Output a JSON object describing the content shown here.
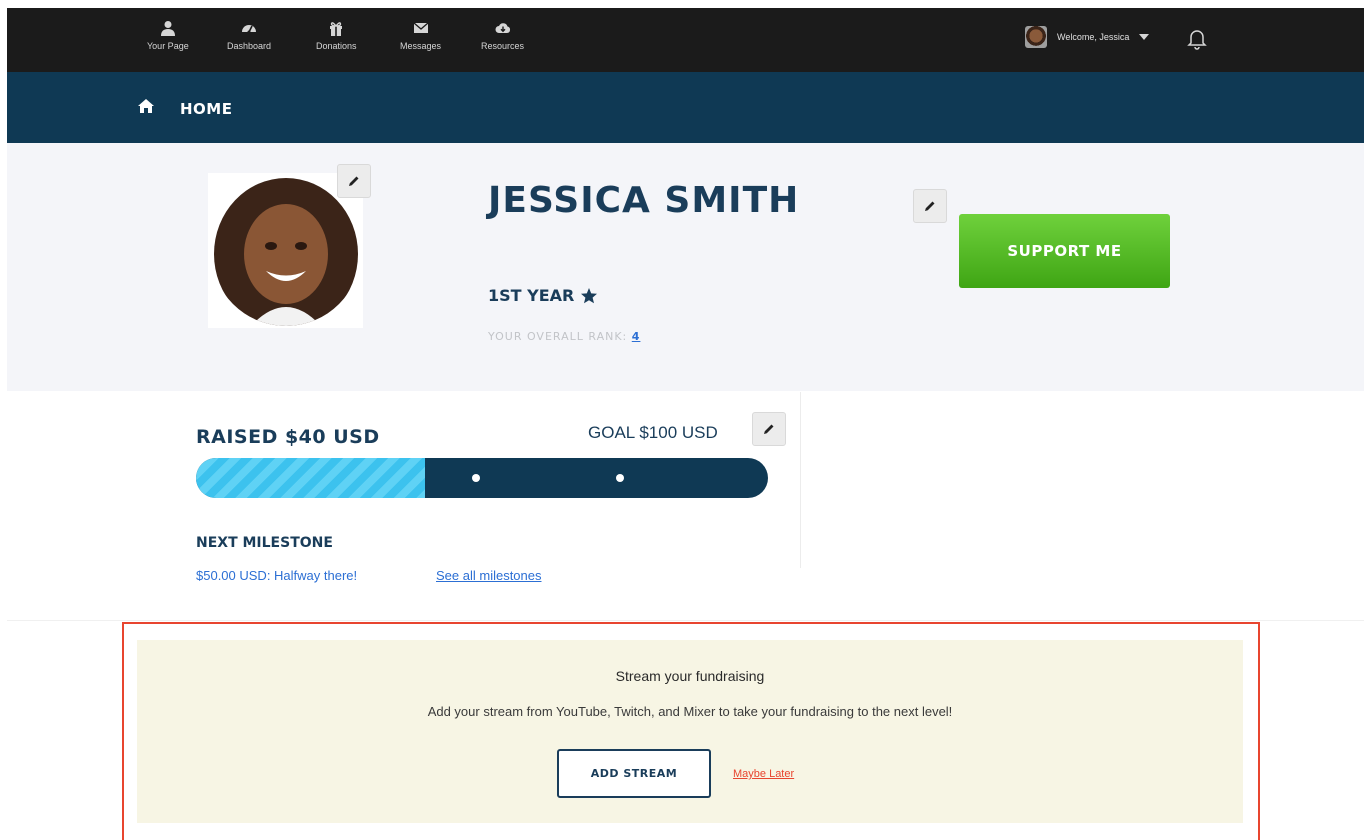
{
  "nav": {
    "items": [
      {
        "label": "Your Page",
        "icon": "user-icon"
      },
      {
        "label": "Dashboard",
        "icon": "dashboard-icon"
      },
      {
        "label": "Donations",
        "icon": "gift-icon"
      },
      {
        "label": "Messages",
        "icon": "envelope-icon"
      },
      {
        "label": "Resources",
        "icon": "cloud-download-icon"
      }
    ],
    "welcome": "Welcome, Jessica",
    "bell_icon": "bell-icon"
  },
  "breadcrumb": {
    "label": "HOME",
    "icon": "home-icon"
  },
  "profile": {
    "name": "JESSICA SMITH",
    "year": "1ST YEAR",
    "rank_label": "YOUR OVERALL RANK:",
    "rank_value": "4",
    "support_label": "SUPPORT ME"
  },
  "fundraising": {
    "raised": "RAISED $40 USD",
    "goal": "GOAL $100 USD",
    "progress_fraction": 0.4,
    "next_milestone_heading": "NEXT MILESTONE",
    "next_milestone_text": "$50.00 USD: Halfway there!",
    "see_all_label": "See all milestones"
  },
  "stream": {
    "title": "Stream your fundraising",
    "description": "Add your stream from YouTube, Twitch, and Mixer to take your fundraising to the next level!",
    "add_label": "ADD STREAM",
    "later_label": "Maybe Later"
  },
  "colors": {
    "nav_bg": "#1b1b1b",
    "brand_navy": "#0f3954",
    "support_green": "#4cb81f",
    "progress_fill": "#3cc2ee",
    "highlight_red": "#e8452f",
    "link_blue": "#2c6fd4"
  }
}
